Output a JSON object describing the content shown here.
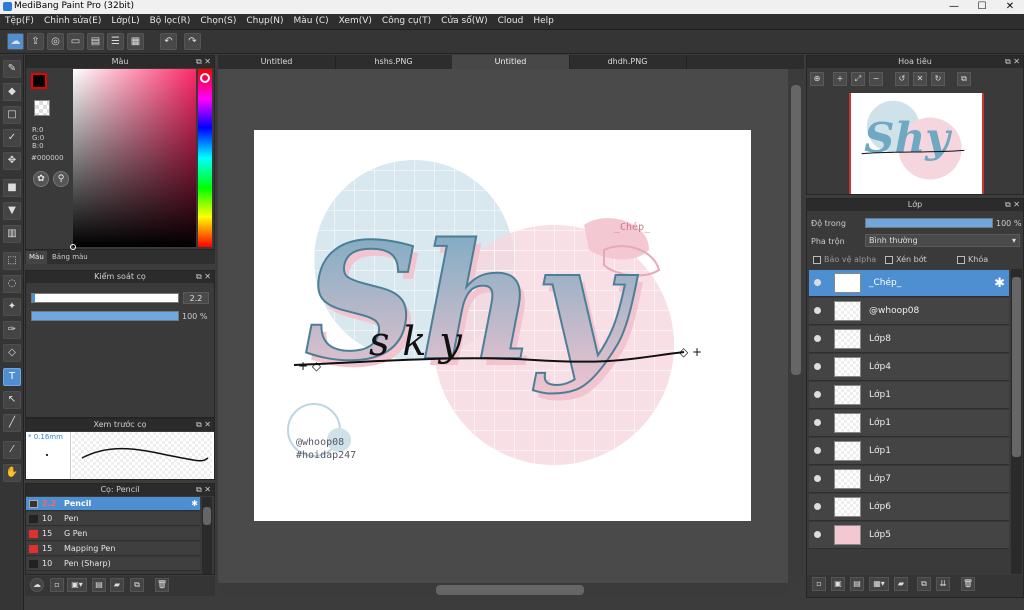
{
  "app": {
    "title": "MediBang Paint Pro (32bit)"
  },
  "window_controls": {
    "minimize": "—",
    "maximize": "☐",
    "close": "✕"
  },
  "menu": [
    "Tệp(F)",
    "Chỉnh sửa(E)",
    "Lớp(L)",
    "Bộ lọc(R)",
    "Chọn(S)",
    "Chụp(N)",
    "Màu (C)",
    "Xem(V)",
    "Công cụ(T)",
    "Cửa sổ(W)",
    "Cloud",
    "Help"
  ],
  "color_panel": {
    "title": "Màu",
    "r": "R:0",
    "g": "G:0",
    "b": "B:0",
    "hex": "#000000",
    "tabs": [
      "Màu",
      "Bảng màu"
    ],
    "fg_color": "#000000"
  },
  "brush_control": {
    "title": "Kiểm soát cọ",
    "size": "2.2",
    "opacity": "100 %",
    "opacity_value": 1.0
  },
  "brush_preview": {
    "title": "Xem trước cọ",
    "size_label": "* 0.16mm"
  },
  "brush_list": {
    "title": "Cọ: Pencil",
    "items": [
      {
        "size": "2.2",
        "name": "Pencil",
        "color": "#3a3a3a",
        "selected": true
      },
      {
        "size": "10",
        "name": "Pen",
        "color": "#2a2a2a",
        "selected": false
      },
      {
        "size": "15",
        "name": "G Pen",
        "color": "#e03030",
        "selected": false
      },
      {
        "size": "15",
        "name": "Mapping Pen",
        "color": "#e03030",
        "selected": false
      },
      {
        "size": "10",
        "name": "Pen (Sharp)",
        "color": "#2a2a2a",
        "selected": false
      }
    ]
  },
  "doc_tabs": [
    {
      "label": "Untitled",
      "active": false
    },
    {
      "label": "hshs.PNG",
      "active": false
    },
    {
      "label": "Untitled",
      "active": true
    },
    {
      "label": "dhdh.PNG",
      "active": false
    }
  ],
  "artwork": {
    "main_text": "Shy",
    "signature": "s k y",
    "top_tag": "_Chép_",
    "credit1": "@whoop08",
    "credit2": "#hoidap247",
    "accent_blue": "#7fb0c8",
    "accent_pink": "#f2c4cf"
  },
  "navigator": {
    "title": "Hoa tiêu"
  },
  "layers": {
    "title": "Lớp",
    "opacity_label": "Độ trong",
    "opacity_value": "100 %",
    "opacity_fraction": 1.0,
    "blend_label": "Pha trộn",
    "blend_mode": "Bình thường",
    "protect_alpha": "Bảo vệ alpha",
    "clip": "Xén bớt",
    "lock": "Khóa",
    "items": [
      {
        "name": "_Chép_",
        "selected": true
      },
      {
        "name": "@whoop08",
        "selected": false
      },
      {
        "name": "Lớp8",
        "selected": false
      },
      {
        "name": "Lớp4",
        "selected": false
      },
      {
        "name": "Lớp1",
        "selected": false
      },
      {
        "name": "Lớp1",
        "selected": false
      },
      {
        "name": "Lớp1",
        "selected": false
      },
      {
        "name": "Lớp7",
        "selected": false
      },
      {
        "name": "Lớp6",
        "selected": false
      },
      {
        "name": "Lớp5",
        "selected": false
      }
    ]
  }
}
